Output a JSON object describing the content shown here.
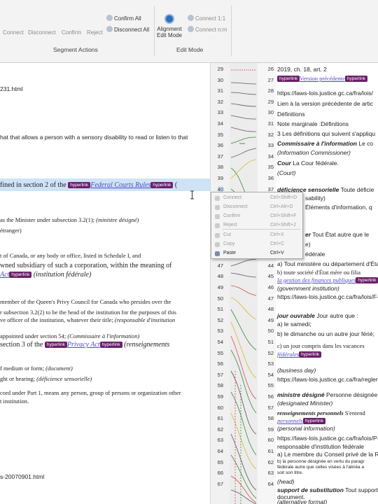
{
  "ribbon": {
    "connect": "Connect",
    "disconnect": "Disconnect",
    "confirm": "Confirm",
    "reject": "Reject",
    "confirm_all": "Confirm All",
    "disconnect_all": "Disconnect All",
    "alignment_edit_mode_line1": "Alignment",
    "alignment_edit_mode_line2": "Edit Mode",
    "connect_1_1": "Connect 1:1",
    "connect_n_m": "Connect n:m",
    "group_segment_actions": "Segment Actions",
    "group_edit_mode": "Edit Mode"
  },
  "tag_label": "hyperlink",
  "left_lines": [
    "231.html",
    "hat that allows a person with a sensory disability to read or listen to that",
    "fined in section 2 of the",
    "Federal Courts Rules",
    "( ",
    "as the Minister under subsection 3.2(1);",
    "(ministre désigné)",
    "étranger)",
    "t of Canada, or any body or office, listed in Schedule I, and",
    "wned subsidiary of such a corporation, within the meaning of",
    "Act",
    "(institution fédérale)",
    "member of the Queen's Privy Council for Canada who presides over the",
    "r subsection 3.2(2) to be the head of the institution for the purposes of this",
    "ve officer of the institution, whatever their title;",
    "(responsable d'institution",
    "appointed under section 54;",
    "(Commissaire à l'information)",
    "section 3 of the",
    "Privacy Act",
    "(renseignements",
    "f medium or form;",
    "(document)",
    "ght or hearing;",
    "(déficience sensorielle)",
    "cord under Part 1, means any person, group of persons or organization other",
    "t institution.",
    "s-20070901.html"
  ],
  "left_nums": [
    "29",
    "30",
    "31",
    "32",
    "33",
    "34",
    "35",
    "36",
    "37",
    "38",
    "39",
    "40",
    "41",
    "42",
    "43",
    "44",
    "45",
    "46",
    "47",
    "48",
    "49",
    "50",
    "51",
    "52",
    "53",
    "54",
    "55",
    "56",
    "57",
    "58",
    "59",
    "60",
    "61",
    "62",
    "63",
    "64",
    "65",
    "66",
    "67"
  ],
  "right_nums": [
    "26",
    "27",
    "28",
    "29",
    "30",
    "31",
    "32",
    "33",
    "34",
    "35",
    "36",
    "37",
    "38",
    "39",
    "40",
    "41",
    "42",
    "43",
    "44",
    "45",
    "46",
    "47",
    "48",
    "49",
    "50",
    "51",
    "52",
    "53",
    "54",
    "55",
    "56",
    "57",
    "58",
    "59",
    "60",
    "61",
    "62",
    "63",
    "64"
  ],
  "right_lines": [
    "2019, ch. 18, art. 2",
    "Version précédente",
    "https://laws-lois.justice.gc.ca/fra/lois/",
    "Lien à la version précédente de artic",
    "Définitions",
    "Note marginale :Définitions",
    "3 Les définitions qui suivent s'appliqu",
    "Commissaire à l'information",
    "Le co",
    "(Information Commissioner)",
    "Cour",
    "La Cour fédérale.",
    "(Court)",
    "déficience sensorielle",
    "Toute déficie",
    "sability)",
    "Éléments d'information, q",
    "er",
    "Tout État autre que le",
    "e)",
    "édérale",
    "a) Tout ministère ou département d'Éta",
    "b) toute société d'État mère ou filia",
    "la gestion des finances publiques",
    "(government institution)",
    "https://laws-lois.justice.gc.ca/fra/lois/F-",
    "jour ouvrable",
    "Jour autre que :",
    "a) le samedi;",
    "b) le dimanche ou un autre jour férié;",
    "c) un jour compris dans les vacances",
    "fédérales",
    "(business day)",
    "https://laws-lois.justice.gc.ca/fra/regleme",
    "ministre désigné",
    "Personne désignée à",
    "(designated Minister)",
    "renseignements personnels",
    "S'entend",
    "personnels",
    "(personal information)",
    "https://laws-lois.justice.gc.ca/fra/lois/P-21",
    "responsable d'institution fédérale",
    "a) Le membre du Conseil privé de la Reine",
    "b) la personne désignée en vertu du paragr",
    "fédérale autre que celles visées à l'alinéa a",
    "soit son titre.",
    "(head)",
    "support de substitution",
    "Tout support perm",
    "document.",
    "(alternative format)"
  ],
  "context_menu": [
    {
      "label": "Connect",
      "shortcut": "Ctrl+Shift+D"
    },
    {
      "label": "Disconnect",
      "shortcut": "Ctrl+Alt+D"
    },
    {
      "label": "Confirm",
      "shortcut": "Ctrl+Shift+F"
    },
    {
      "label": "Reject",
      "shortcut": "Ctrl+Shift+J"
    },
    {
      "label": "Cut",
      "shortcut": "Ctrl+X"
    },
    {
      "label": "Copy",
      "shortcut": "Ctrl+C"
    },
    {
      "label": "Paste",
      "shortcut": "Ctrl+V"
    }
  ]
}
